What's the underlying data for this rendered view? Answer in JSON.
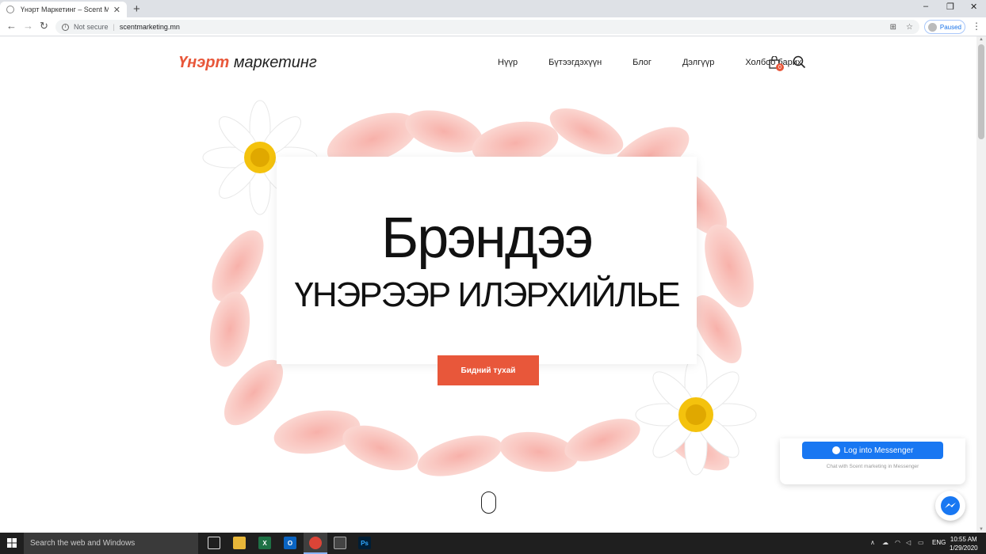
{
  "browser": {
    "tab_title": "Үнэрт Маркетинг – Scent Marke",
    "tab_close": "✕",
    "new_tab": "+",
    "not_secure": "Not secure",
    "url": "scentmarketing.mn",
    "profile_status": "Paused",
    "window_minimize": "–",
    "window_restore": "❐",
    "window_close": "✕"
  },
  "site": {
    "logo_accent": "Үнэрт",
    "logo_rest": "маркетинг",
    "nav": [
      "Нүүр",
      "Бүтээгдэхүүн",
      "Блог",
      "Дэлгүүр",
      "Холбоо барих"
    ],
    "cart_count": "0",
    "accent_color": "#e8573a"
  },
  "hero": {
    "title": "Брэндээ",
    "subtitle": "ҮНЭРЭЭР ИЛЭРХИЙЛЬЕ",
    "button_label": "Бидний тухай"
  },
  "messenger": {
    "login_label": "Log into Messenger",
    "caption": "Chat with Scent marketing in Messenger",
    "brand_color": "#1877f2"
  },
  "taskbar": {
    "search_placeholder": "Search the web and Windows",
    "language": "ENG",
    "time": "10:55 AM",
    "date": "1/29/2020"
  }
}
